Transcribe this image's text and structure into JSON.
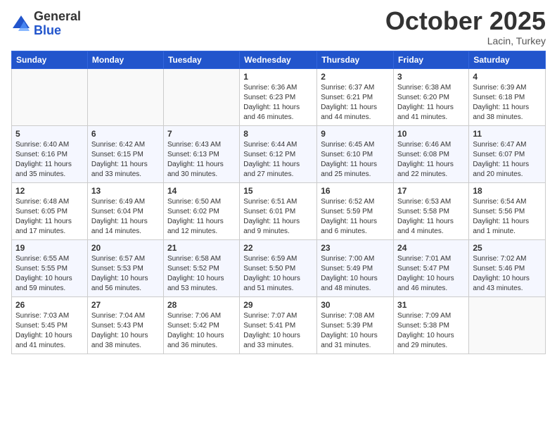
{
  "logo": {
    "general": "General",
    "blue": "Blue"
  },
  "title": "October 2025",
  "location": "Lacin, Turkey",
  "weekdays": [
    "Sunday",
    "Monday",
    "Tuesday",
    "Wednesday",
    "Thursday",
    "Friday",
    "Saturday"
  ],
  "weeks": [
    [
      {
        "day": "",
        "info": ""
      },
      {
        "day": "",
        "info": ""
      },
      {
        "day": "",
        "info": ""
      },
      {
        "day": "1",
        "info": "Sunrise: 6:36 AM\nSunset: 6:23 PM\nDaylight: 11 hours\nand 46 minutes."
      },
      {
        "day": "2",
        "info": "Sunrise: 6:37 AM\nSunset: 6:21 PM\nDaylight: 11 hours\nand 44 minutes."
      },
      {
        "day": "3",
        "info": "Sunrise: 6:38 AM\nSunset: 6:20 PM\nDaylight: 11 hours\nand 41 minutes."
      },
      {
        "day": "4",
        "info": "Sunrise: 6:39 AM\nSunset: 6:18 PM\nDaylight: 11 hours\nand 38 minutes."
      }
    ],
    [
      {
        "day": "5",
        "info": "Sunrise: 6:40 AM\nSunset: 6:16 PM\nDaylight: 11 hours\nand 35 minutes."
      },
      {
        "day": "6",
        "info": "Sunrise: 6:42 AM\nSunset: 6:15 PM\nDaylight: 11 hours\nand 33 minutes."
      },
      {
        "day": "7",
        "info": "Sunrise: 6:43 AM\nSunset: 6:13 PM\nDaylight: 11 hours\nand 30 minutes."
      },
      {
        "day": "8",
        "info": "Sunrise: 6:44 AM\nSunset: 6:12 PM\nDaylight: 11 hours\nand 27 minutes."
      },
      {
        "day": "9",
        "info": "Sunrise: 6:45 AM\nSunset: 6:10 PM\nDaylight: 11 hours\nand 25 minutes."
      },
      {
        "day": "10",
        "info": "Sunrise: 6:46 AM\nSunset: 6:08 PM\nDaylight: 11 hours\nand 22 minutes."
      },
      {
        "day": "11",
        "info": "Sunrise: 6:47 AM\nSunset: 6:07 PM\nDaylight: 11 hours\nand 20 minutes."
      }
    ],
    [
      {
        "day": "12",
        "info": "Sunrise: 6:48 AM\nSunset: 6:05 PM\nDaylight: 11 hours\nand 17 minutes."
      },
      {
        "day": "13",
        "info": "Sunrise: 6:49 AM\nSunset: 6:04 PM\nDaylight: 11 hours\nand 14 minutes."
      },
      {
        "day": "14",
        "info": "Sunrise: 6:50 AM\nSunset: 6:02 PM\nDaylight: 11 hours\nand 12 minutes."
      },
      {
        "day": "15",
        "info": "Sunrise: 6:51 AM\nSunset: 6:01 PM\nDaylight: 11 hours\nand 9 minutes."
      },
      {
        "day": "16",
        "info": "Sunrise: 6:52 AM\nSunset: 5:59 PM\nDaylight: 11 hours\nand 6 minutes."
      },
      {
        "day": "17",
        "info": "Sunrise: 6:53 AM\nSunset: 5:58 PM\nDaylight: 11 hours\nand 4 minutes."
      },
      {
        "day": "18",
        "info": "Sunrise: 6:54 AM\nSunset: 5:56 PM\nDaylight: 11 hours\nand 1 minute."
      }
    ],
    [
      {
        "day": "19",
        "info": "Sunrise: 6:55 AM\nSunset: 5:55 PM\nDaylight: 10 hours\nand 59 minutes."
      },
      {
        "day": "20",
        "info": "Sunrise: 6:57 AM\nSunset: 5:53 PM\nDaylight: 10 hours\nand 56 minutes."
      },
      {
        "day": "21",
        "info": "Sunrise: 6:58 AM\nSunset: 5:52 PM\nDaylight: 10 hours\nand 53 minutes."
      },
      {
        "day": "22",
        "info": "Sunrise: 6:59 AM\nSunset: 5:50 PM\nDaylight: 10 hours\nand 51 minutes."
      },
      {
        "day": "23",
        "info": "Sunrise: 7:00 AM\nSunset: 5:49 PM\nDaylight: 10 hours\nand 48 minutes."
      },
      {
        "day": "24",
        "info": "Sunrise: 7:01 AM\nSunset: 5:47 PM\nDaylight: 10 hours\nand 46 minutes."
      },
      {
        "day": "25",
        "info": "Sunrise: 7:02 AM\nSunset: 5:46 PM\nDaylight: 10 hours\nand 43 minutes."
      }
    ],
    [
      {
        "day": "26",
        "info": "Sunrise: 7:03 AM\nSunset: 5:45 PM\nDaylight: 10 hours\nand 41 minutes."
      },
      {
        "day": "27",
        "info": "Sunrise: 7:04 AM\nSunset: 5:43 PM\nDaylight: 10 hours\nand 38 minutes."
      },
      {
        "day": "28",
        "info": "Sunrise: 7:06 AM\nSunset: 5:42 PM\nDaylight: 10 hours\nand 36 minutes."
      },
      {
        "day": "29",
        "info": "Sunrise: 7:07 AM\nSunset: 5:41 PM\nDaylight: 10 hours\nand 33 minutes."
      },
      {
        "day": "30",
        "info": "Sunrise: 7:08 AM\nSunset: 5:39 PM\nDaylight: 10 hours\nand 31 minutes."
      },
      {
        "day": "31",
        "info": "Sunrise: 7:09 AM\nSunset: 5:38 PM\nDaylight: 10 hours\nand 29 minutes."
      },
      {
        "day": "",
        "info": ""
      }
    ]
  ]
}
